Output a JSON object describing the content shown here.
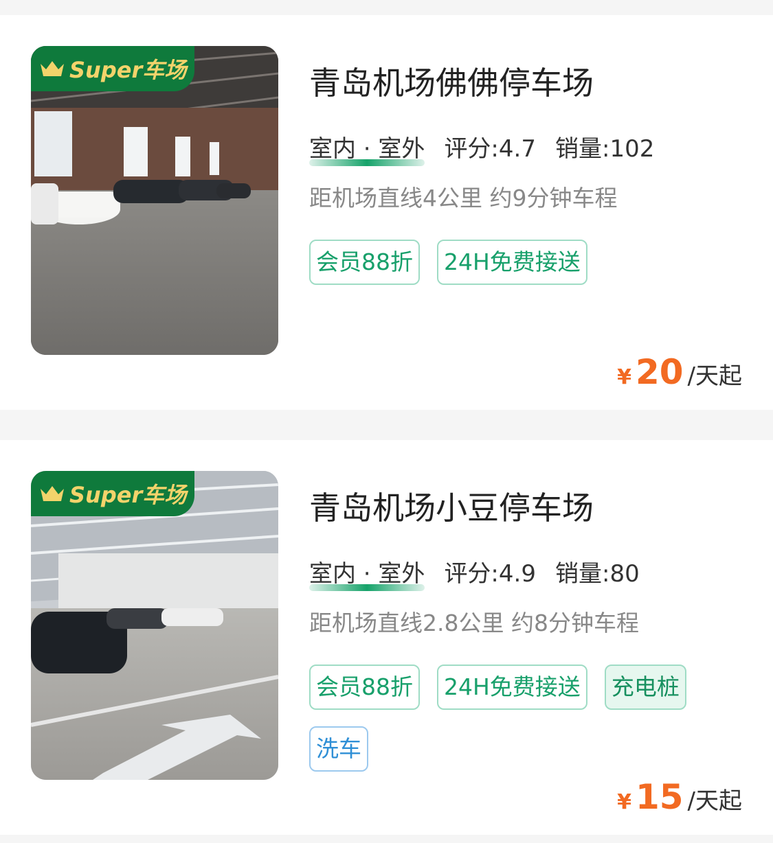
{
  "badge": {
    "label": "Super车场",
    "icon": "crown-icon",
    "bg_color": "#0f7a3c",
    "text_color": "#f3d36b"
  },
  "colors": {
    "accent_green": "#18a06b",
    "price_orange": "#f26a22",
    "tag_blue": "#2f8fd6"
  },
  "listings": [
    {
      "title": "青岛机场佛佛停车场",
      "type": "室内 · 室外",
      "rating_label": "评分:",
      "rating": "4.7",
      "sales_label": "销量:",
      "sales": "102",
      "distance": "距机场直线4公里 约9分钟车程",
      "tags": [
        "会员88折",
        "24H免费接送"
      ],
      "price_symbol": "¥",
      "price": "20",
      "price_unit": "/天起"
    },
    {
      "title": "青岛机场小豆停车场",
      "type": "室内 · 室外",
      "rating_label": "评分:",
      "rating": "4.9",
      "sales_label": "销量:",
      "sales": "80",
      "distance": "距机场直线2.8公里 约8分钟车程",
      "tags": [
        "会员88折",
        "24H免费接送"
      ],
      "extra_tags": [
        "充电桩",
        "洗车"
      ],
      "price_symbol": "¥",
      "price": "15",
      "price_unit": "/天起"
    }
  ]
}
